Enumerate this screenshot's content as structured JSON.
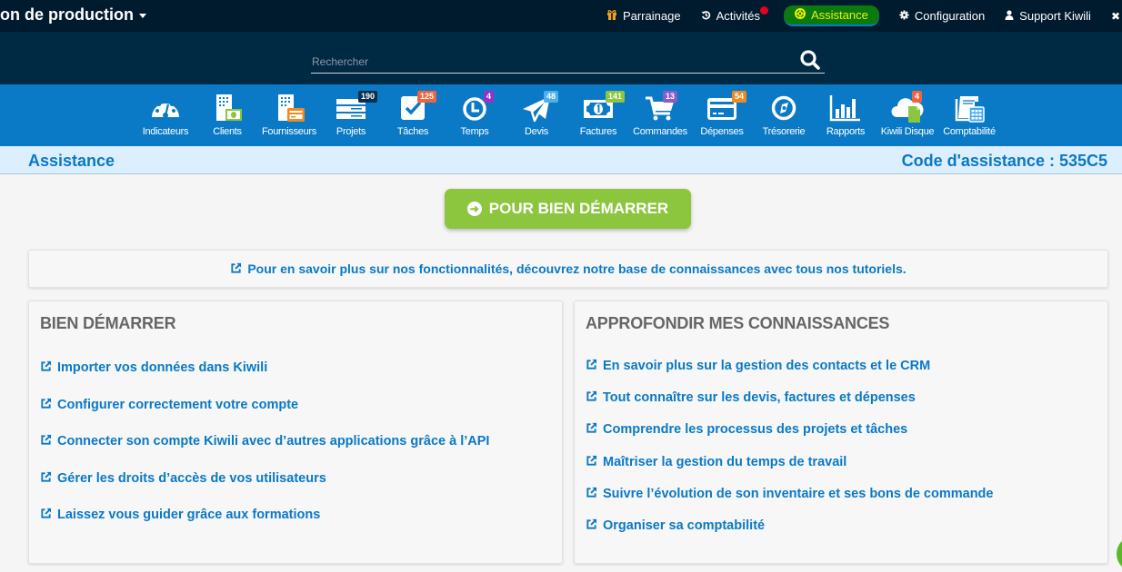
{
  "topbar": {
    "company": "on de production",
    "nav": [
      {
        "icon": "gift-icon",
        "label": "Parrainage"
      },
      {
        "icon": "history-icon",
        "label": "Activités",
        "notification": true
      },
      {
        "icon": "lifebuoy-icon",
        "label": "Assistance",
        "active": true
      },
      {
        "icon": "gear-icon",
        "label": "Configuration"
      },
      {
        "icon": "user-icon",
        "label": "Support Kiwili"
      }
    ]
  },
  "search": {
    "placeholder": "Rechercher",
    "value": ""
  },
  "modules": [
    {
      "label": "Indicateurs",
      "icon": "dashboard-icon"
    },
    {
      "label": "Clients",
      "icon": "clients-icon"
    },
    {
      "label": "Fournisseurs",
      "icon": "suppliers-icon"
    },
    {
      "label": "Projets",
      "icon": "projects-icon",
      "badge": "190",
      "badge_color": "#0a3050"
    },
    {
      "label": "Tâches",
      "icon": "tasks-icon",
      "badge": "125",
      "badge_color": "#f0643c"
    },
    {
      "label": "Temps",
      "icon": "clock-icon",
      "badge": "4",
      "badge_color": "#9b30c8"
    },
    {
      "label": "Devis",
      "icon": "paper-plane-icon",
      "badge": "48",
      "badge_color": "#4db0e8"
    },
    {
      "label": "Factures",
      "icon": "invoice-icon",
      "badge": "141",
      "badge_color": "#8cc63f"
    },
    {
      "label": "Commandes",
      "icon": "cart-icon",
      "badge": "13",
      "badge_color": "#8a5cc8"
    },
    {
      "label": "Dépenses",
      "icon": "credit-card-icon",
      "badge": "54",
      "badge_color": "#f08a20"
    },
    {
      "label": "Trésorerie",
      "icon": "compass-icon"
    },
    {
      "label": "Rapports",
      "icon": "bar-chart-icon"
    },
    {
      "label": "Kiwili Disque",
      "icon": "cloud-file-icon",
      "badge": "4",
      "badge_color": "#f0643c"
    },
    {
      "label": "Comptabilité",
      "icon": "ledger-icon"
    }
  ],
  "page": {
    "title": "Assistance",
    "code": "Code d'assistance : 535C5",
    "start_button": "POUR BIEN DÉMARRER",
    "info_link": "Pour en savoir plus sur nos fonctionnalités, découvrez notre base de connaissances avec tous nos tutoriels."
  },
  "cards": {
    "left": {
      "title": "BIEN DÉMARRER",
      "links": [
        "Importer vos données dans Kiwili",
        "Configurer correctement votre compte",
        "Connecter son compte Kiwili avec d’autres applications grâce à l’API",
        "Gérer les droits d’accès de vos utilisateurs",
        "Laissez vous guider grâce aux formations"
      ]
    },
    "right": {
      "title": "APPROFONDIR MES CONNAISSANCES",
      "links": [
        "En savoir plus sur la gestion des contacts et le CRM",
        "Tout connaître sur les devis, factures et dépenses",
        "Comprendre les processus des projets et tâches",
        "Maîtriser la gestion du temps de travail",
        "Suivre l’évolution de son inventaire et ses bons de commande",
        "Organiser sa comptabilité"
      ]
    }
  }
}
